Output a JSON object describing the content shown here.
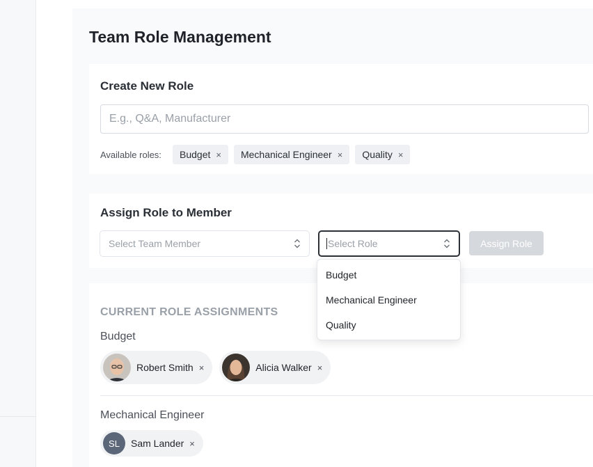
{
  "page": {
    "title": "Team Role Management"
  },
  "create_role": {
    "title": "Create New Role",
    "input_placeholder": "E.g., Q&A, Manufacturer",
    "input_value": "",
    "available_label": "Available roles:",
    "available_roles": [
      "Budget",
      "Mechanical Engineer",
      "Quality"
    ],
    "remove_glyph": "×"
  },
  "assign_role": {
    "title": "Assign Role to Member",
    "member_placeholder": "Select Team Member",
    "role_placeholder": "Select Role",
    "button_label": "Assign Role",
    "role_options": [
      "Budget",
      "Mechanical Engineer",
      "Quality"
    ]
  },
  "current": {
    "heading": "CURRENT ROLE ASSIGNMENTS",
    "groups": [
      {
        "role": "Budget",
        "members": [
          {
            "name": "Robert Smith"
          },
          {
            "name": "Alicia Walker"
          }
        ]
      },
      {
        "role": "Mechanical Engineer",
        "members": [
          {
            "name": "Sam Lander",
            "initials": "SL"
          }
        ]
      }
    ]
  },
  "icons": {
    "remove": "close-icon",
    "caret": "chevron-up-down-icon"
  },
  "colors": {
    "disabled_button": "#d5d8dc",
    "chip_bg": "#eef0f3",
    "initials_avatar": "#5b6678",
    "heading_muted": "#9aa0a8"
  }
}
